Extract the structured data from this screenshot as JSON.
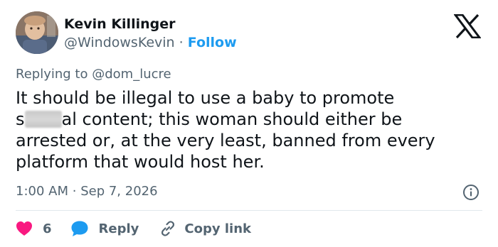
{
  "author": {
    "name": "Kevin Killinger",
    "handle": "@WindowsKevin",
    "separator": "·",
    "follow_label": "Follow",
    "avatar_icon": "profile-photo"
  },
  "reply_context": {
    "prefix": "Replying to",
    "mention": "@dom_lucre"
  },
  "tweet": {
    "line1": "It should be illegal to use a baby to promote",
    "line2_start": "s",
    "line2_end": "al content; this woman should either be",
    "line3": "arrested or, at the very least, banned from every",
    "line4": "platform that would host her."
  },
  "timestamp": {
    "time": "1:00 AM",
    "separator": "·",
    "date": "Sep 7, 2026"
  },
  "actions": {
    "like_count": "6",
    "reply_label": "Reply",
    "copy_label": "Copy link"
  },
  "colors": {
    "accent": "#1d9bf0",
    "like": "#f91880",
    "muted": "#536471",
    "text": "#0f1419"
  },
  "icons": {
    "brand": "x-logo-icon",
    "info": "info-icon",
    "like": "heart-icon",
    "reply": "speech-bubble-icon",
    "copy": "link-icon"
  }
}
